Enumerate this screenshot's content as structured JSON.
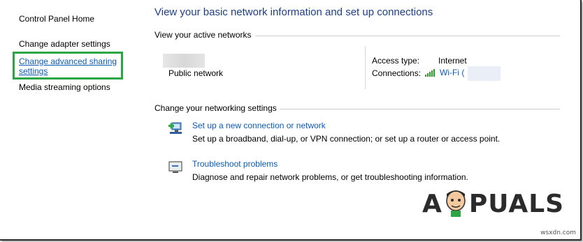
{
  "sidebar": {
    "home": "Control Panel Home",
    "adapter": "Change adapter settings",
    "sharing": "Change advanced sharing settings",
    "media": "Media streaming options"
  },
  "main": {
    "title": "View your basic network information and set up connections",
    "active_header": "View your active networks",
    "network_type": "Public network",
    "access_label": "Access type:",
    "access_value": "Internet",
    "connections_label": "Connections:",
    "connection_name": "Wi-Fi (",
    "settings_header": "Change your networking settings",
    "tasks": [
      {
        "title": "Set up a new connection or network",
        "desc": "Set up a broadband, dial-up, or VPN connection; or set up a router or access point.",
        "icon": "network-setup-icon"
      },
      {
        "title": "Troubleshoot problems",
        "desc": "Diagnose and repair network problems, or get troubleshooting information.",
        "icon": "troubleshoot-icon"
      }
    ]
  },
  "branding": {
    "logo": "APPUALS",
    "watermark": "wsxdn.com"
  },
  "colors": {
    "link": "#0b5bb5",
    "title": "#1e3d8a",
    "highlight": "#2aa644"
  }
}
